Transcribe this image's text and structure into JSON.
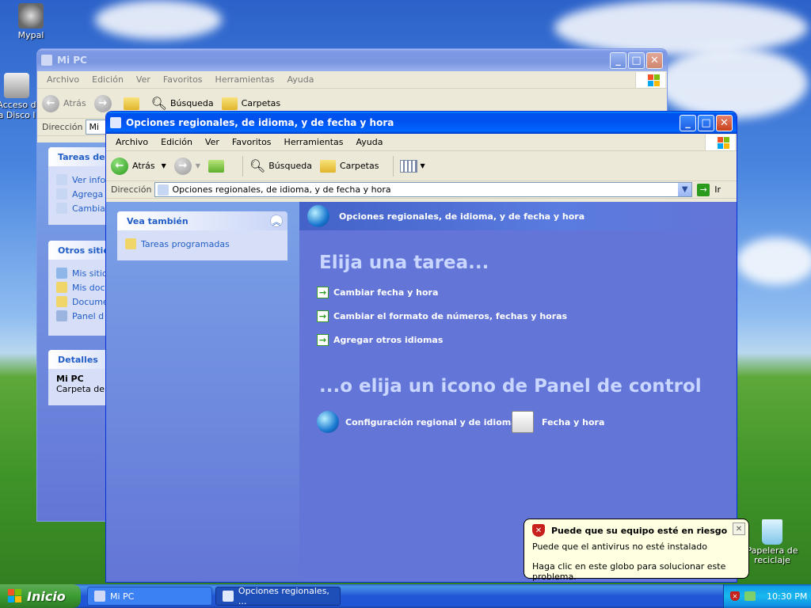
{
  "desktop": {
    "icons": [
      {
        "label": "Mypal"
      },
      {
        "label": "Acceso d a Disco l"
      },
      {
        "label": "Papelera de reciclaje"
      }
    ]
  },
  "back_window": {
    "title": "Mi PC",
    "menu": [
      "Archivo",
      "Edición",
      "Ver",
      "Favoritos",
      "Herramientas",
      "Ayuda"
    ],
    "toolbar": {
      "back": "Atrás",
      "search": "Búsqueda",
      "folders": "Carpetas"
    },
    "address_label": "Dirección",
    "address_value": "Mi",
    "panes": [
      {
        "title": "Tareas del",
        "items": [
          "Ver info",
          "Agrega",
          "Cambia"
        ]
      },
      {
        "title": "Otros sitio",
        "items": [
          "Mis sitio",
          "Mis doc",
          "Docume",
          "Panel d"
        ]
      },
      {
        "title": "Detalles",
        "items": [
          "Mi PC",
          "Carpeta del"
        ]
      }
    ]
  },
  "front_window": {
    "title": "Opciones regionales, de idioma, y de fecha y hora",
    "menu": [
      "Archivo",
      "Edición",
      "Ver",
      "Favoritos",
      "Herramientas",
      "Ayuda"
    ],
    "toolbar": {
      "back": "Atrás",
      "search": "Búsqueda",
      "folders": "Carpetas"
    },
    "address_label": "Dirección",
    "address_value": "Opciones regionales, de idioma, y de fecha y hora",
    "go_label": "Ir",
    "see_also": {
      "title": "Vea también",
      "items": [
        "Tareas programadas"
      ]
    },
    "category_title": "Opciones regionales, de idioma, y de fecha y hora",
    "pick_task": "Elija una tarea...",
    "tasks": [
      "Cambiar fecha y hora",
      "Cambiar el formato de números, fechas y horas",
      "Agregar otros idiomas"
    ],
    "pick_icon": "...o elija un icono de Panel de control",
    "icons": [
      "Configuración regional y de idioma",
      "Fecha y hora"
    ]
  },
  "balloon": {
    "title": "Puede que su equipo esté en riesgo",
    "line1": "Puede que el antivirus no esté instalado",
    "line2": "Haga clic en este globo para solucionar este problema."
  },
  "taskbar": {
    "start": "Inicio",
    "buttons": [
      "Mi PC",
      "Opciones regionales, ..."
    ],
    "clock": "10:30 PM"
  }
}
